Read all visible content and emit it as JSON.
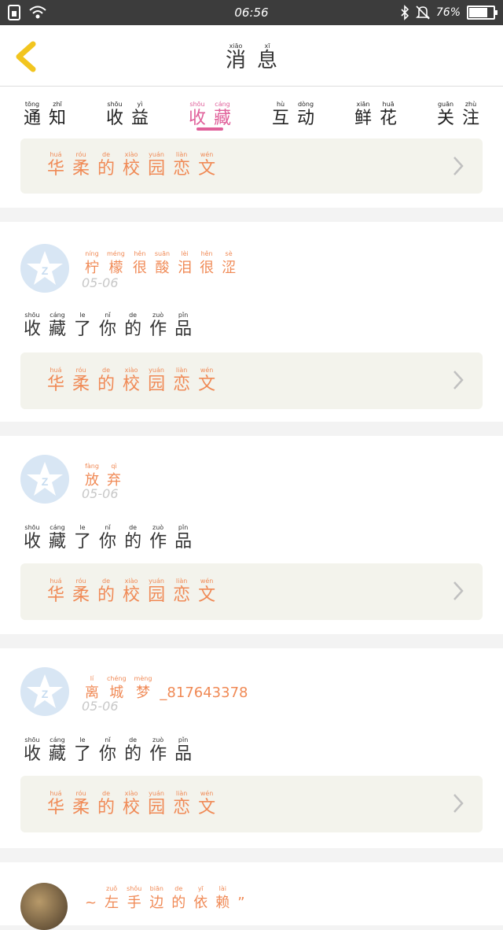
{
  "status_bar": {
    "time": "06:56",
    "battery": "76%",
    "battery_level": 0.76,
    "icons": [
      "sim-icon",
      "wifi-icon",
      "bluetooth-icon",
      "silent-bell-icon",
      "battery-icon"
    ]
  },
  "header": {
    "title": [
      {
        "py": "xiāo",
        "hz": "消"
      },
      {
        "py": "xī",
        "hz": "息"
      }
    ]
  },
  "tabs": [
    {
      "chars": [
        {
          "py": "tōng",
          "hz": "通"
        },
        {
          "py": "zhī",
          "hz": "知"
        }
      ],
      "active": false
    },
    {
      "chars": [
        {
          "py": "shōu",
          "hz": "收"
        },
        {
          "py": "yì",
          "hz": "益"
        }
      ],
      "active": false
    },
    {
      "chars": [
        {
          "py": "shōu",
          "hz": "收"
        },
        {
          "py": "cáng",
          "hz": "藏"
        }
      ],
      "active": true
    },
    {
      "chars": [
        {
          "py": "hù",
          "hz": "互"
        },
        {
          "py": "dòng",
          "hz": "动"
        }
      ],
      "active": false
    },
    {
      "chars": [
        {
          "py": "xiān",
          "hz": "鲜"
        },
        {
          "py": "huā",
          "hz": "花"
        }
      ],
      "active": false
    },
    {
      "chars": [
        {
          "py": "guān",
          "hz": "关"
        },
        {
          "py": "zhù",
          "hz": "注"
        }
      ],
      "active": false
    }
  ],
  "work_title": [
    {
      "py": "huá",
      "hz": "华"
    },
    {
      "py": "róu",
      "hz": "柔"
    },
    {
      "py": "de",
      "hz": "的"
    },
    {
      "py": "xiào",
      "hz": "校"
    },
    {
      "py": "yuán",
      "hz": "园"
    },
    {
      "py": "liàn",
      "hz": "恋"
    },
    {
      "py": "wén",
      "hz": "文"
    }
  ],
  "action_text": [
    {
      "py": "shōu",
      "hz": "收"
    },
    {
      "py": "cáng",
      "hz": "藏"
    },
    {
      "py": "le",
      "hz": "了"
    },
    {
      "py": "nǐ",
      "hz": "你"
    },
    {
      "py": "de",
      "hz": "的"
    },
    {
      "py": "zuò",
      "hz": "作"
    },
    {
      "py": "pǐn",
      "hz": "品"
    }
  ],
  "notifications": [
    {
      "username": [
        {
          "py": "níng",
          "hz": "柠"
        },
        {
          "py": "méng",
          "hz": "檬"
        },
        {
          "py": "hěn",
          "hz": "很"
        },
        {
          "py": "suān",
          "hz": "酸"
        },
        {
          "py": "lèi",
          "hz": "泪"
        },
        {
          "py": "hěn",
          "hz": "很"
        },
        {
          "py": "sè",
          "hz": "涩"
        }
      ],
      "date": "05-06"
    },
    {
      "username": [
        {
          "py": "fàng",
          "hz": "放"
        },
        {
          "py": "qì",
          "hz": "弃"
        }
      ],
      "date": "05-06"
    },
    {
      "username": [
        {
          "py": "lí",
          "hz": "离"
        },
        {
          "py": "chéng",
          "hz": "城"
        },
        {
          "py": "mèng",
          "hz": "梦"
        },
        {
          "py": "",
          "hz": "_817643378"
        }
      ],
      "date": "05-06"
    }
  ],
  "partial_item": {
    "username": [
      {
        "py": "",
        "hz": "~"
      },
      {
        "py": "zuǒ",
        "hz": "左"
      },
      {
        "py": "shǒu",
        "hz": "手"
      },
      {
        "py": "biān",
        "hz": "边"
      },
      {
        "py": "de",
        "hz": "的"
      },
      {
        "py": "yī",
        "hz": "依"
      },
      {
        "py": "lài",
        "hz": "赖"
      },
      {
        "py": "",
        "hz": "”"
      }
    ]
  },
  "colors": {
    "accent_pink": "#e0609a",
    "orange_text": "#f08a56",
    "status_bar": "#3c3c3c"
  }
}
